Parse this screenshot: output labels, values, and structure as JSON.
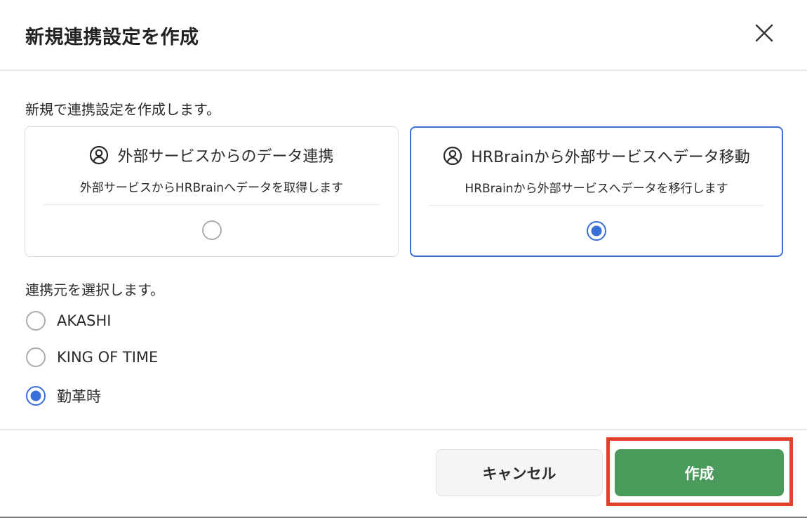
{
  "dialog": {
    "title": "新規連携設定を作成",
    "close_icon": "close-icon"
  },
  "intro": "新規で連携設定を作成します。",
  "direction_options": [
    {
      "icon": "user-circle-icon",
      "title": "外部サービスからのデータ連携",
      "description": "外部サービスからHRBrainへデータを取得します",
      "selected": false
    },
    {
      "icon": "user-circle-icon",
      "title": "HRBrainから外部サービスへデータ移動",
      "description": "HRBrainから外部サービスへデータを移行します",
      "selected": true
    }
  ],
  "source": {
    "label": "連携元を選択します。",
    "options": [
      {
        "label": "AKASHI",
        "selected": false
      },
      {
        "label": "KING OF TIME",
        "selected": false
      },
      {
        "label": "勤革時",
        "selected": true
      }
    ]
  },
  "footer": {
    "cancel_label": "キャンセル",
    "create_label": "作成"
  },
  "colors": {
    "accent": "#3b6fd8",
    "create_button": "#4a9a5c",
    "highlight_box": "#e0432c"
  }
}
